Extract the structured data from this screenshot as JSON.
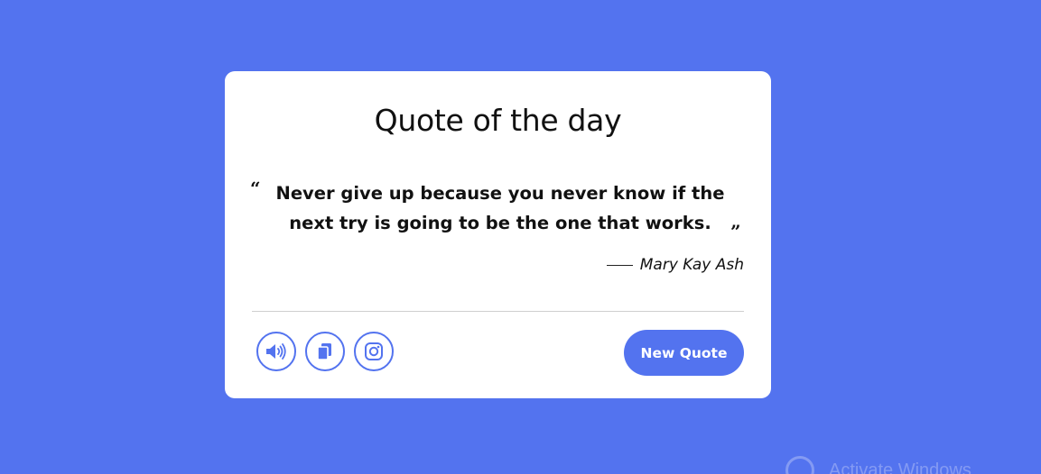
{
  "card": {
    "title": "Quote of the day",
    "quote_open": "“",
    "quote_text": "Never give up because you never know if the next try is going to be the one that works.",
    "quote_close": "”",
    "author": "Mary Kay Ash",
    "new_quote_label": "New Quote"
  },
  "actions": [
    {
      "icon": "speaker-icon"
    },
    {
      "icon": "copy-icon"
    },
    {
      "icon": "instagram-icon"
    }
  ],
  "watermark": {
    "text": "Activate Windows"
  },
  "colors": {
    "background": "#5373ef",
    "accent": "#5373ef",
    "card": "#ffffff",
    "text": "#111111"
  }
}
